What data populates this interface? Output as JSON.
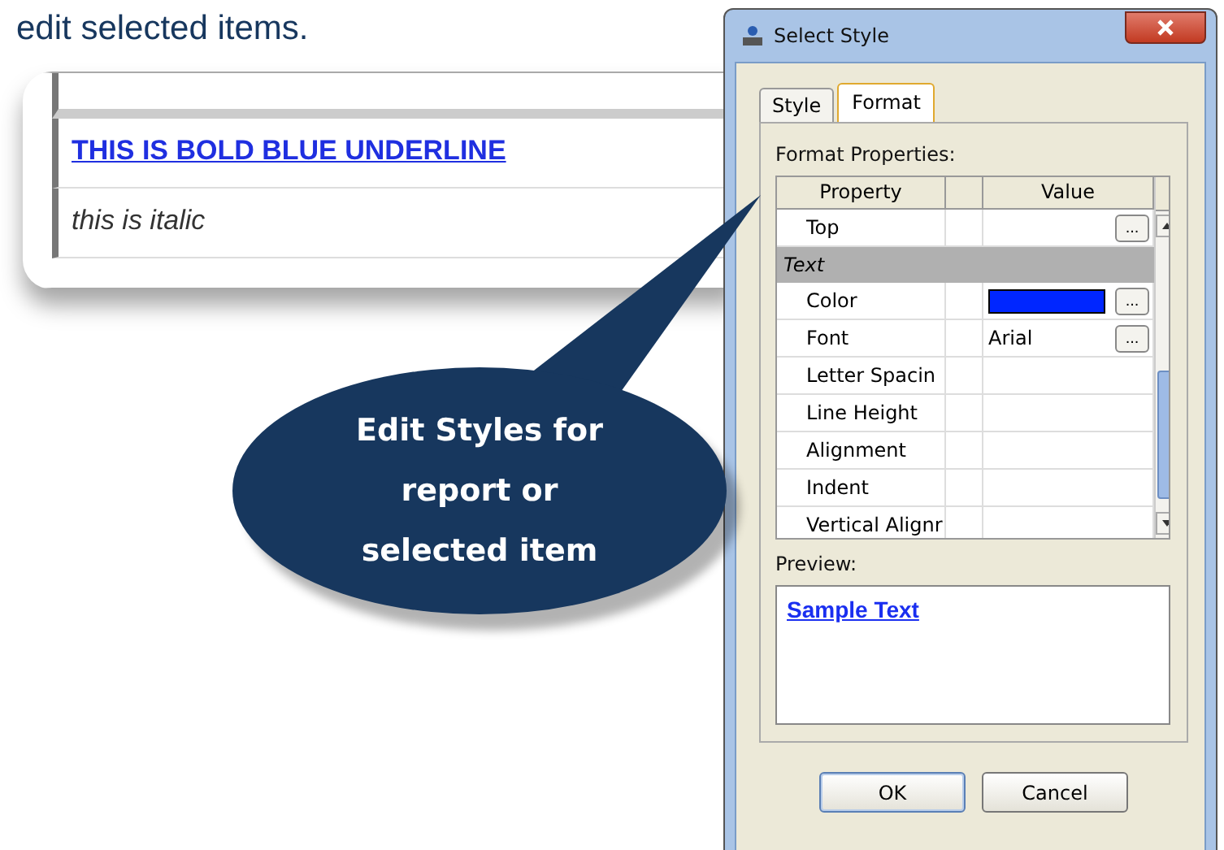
{
  "heading": "edit selected items.",
  "report_excerpt": {
    "lines": [
      {
        "text": "THIS IS BOLD BLUE UNDERLINE",
        "kind": "bold-underline"
      },
      {
        "text": "this is italic",
        "kind": "italic"
      }
    ]
  },
  "callout": {
    "text": "Edit Styles for report or selected item"
  },
  "dialog": {
    "title": "Select Style",
    "tabs": [
      {
        "label": "Style",
        "selected": false
      },
      {
        "label": "Format",
        "selected": true
      }
    ],
    "properties_label": "Format Properties:",
    "columns": [
      "Property",
      "Value"
    ],
    "rows": [
      {
        "kind": "row",
        "property": "Top",
        "value_button": "..."
      },
      {
        "kind": "section",
        "property": "Text"
      },
      {
        "kind": "swatch",
        "property": "Color",
        "color": "#0026ff",
        "value_button": "..."
      },
      {
        "kind": "row",
        "property": "Font",
        "value": "Arial",
        "value_button": "..."
      },
      {
        "kind": "row",
        "property": "Letter Spacin"
      },
      {
        "kind": "row",
        "property": "Line Height"
      },
      {
        "kind": "row",
        "property": "Alignment"
      },
      {
        "kind": "row",
        "property": "Indent"
      },
      {
        "kind": "row",
        "property": "Vertical Alignr"
      }
    ],
    "preview_label": "Preview:",
    "preview_text": "Sample Text",
    "buttons": [
      "OK",
      "Cancel"
    ]
  }
}
